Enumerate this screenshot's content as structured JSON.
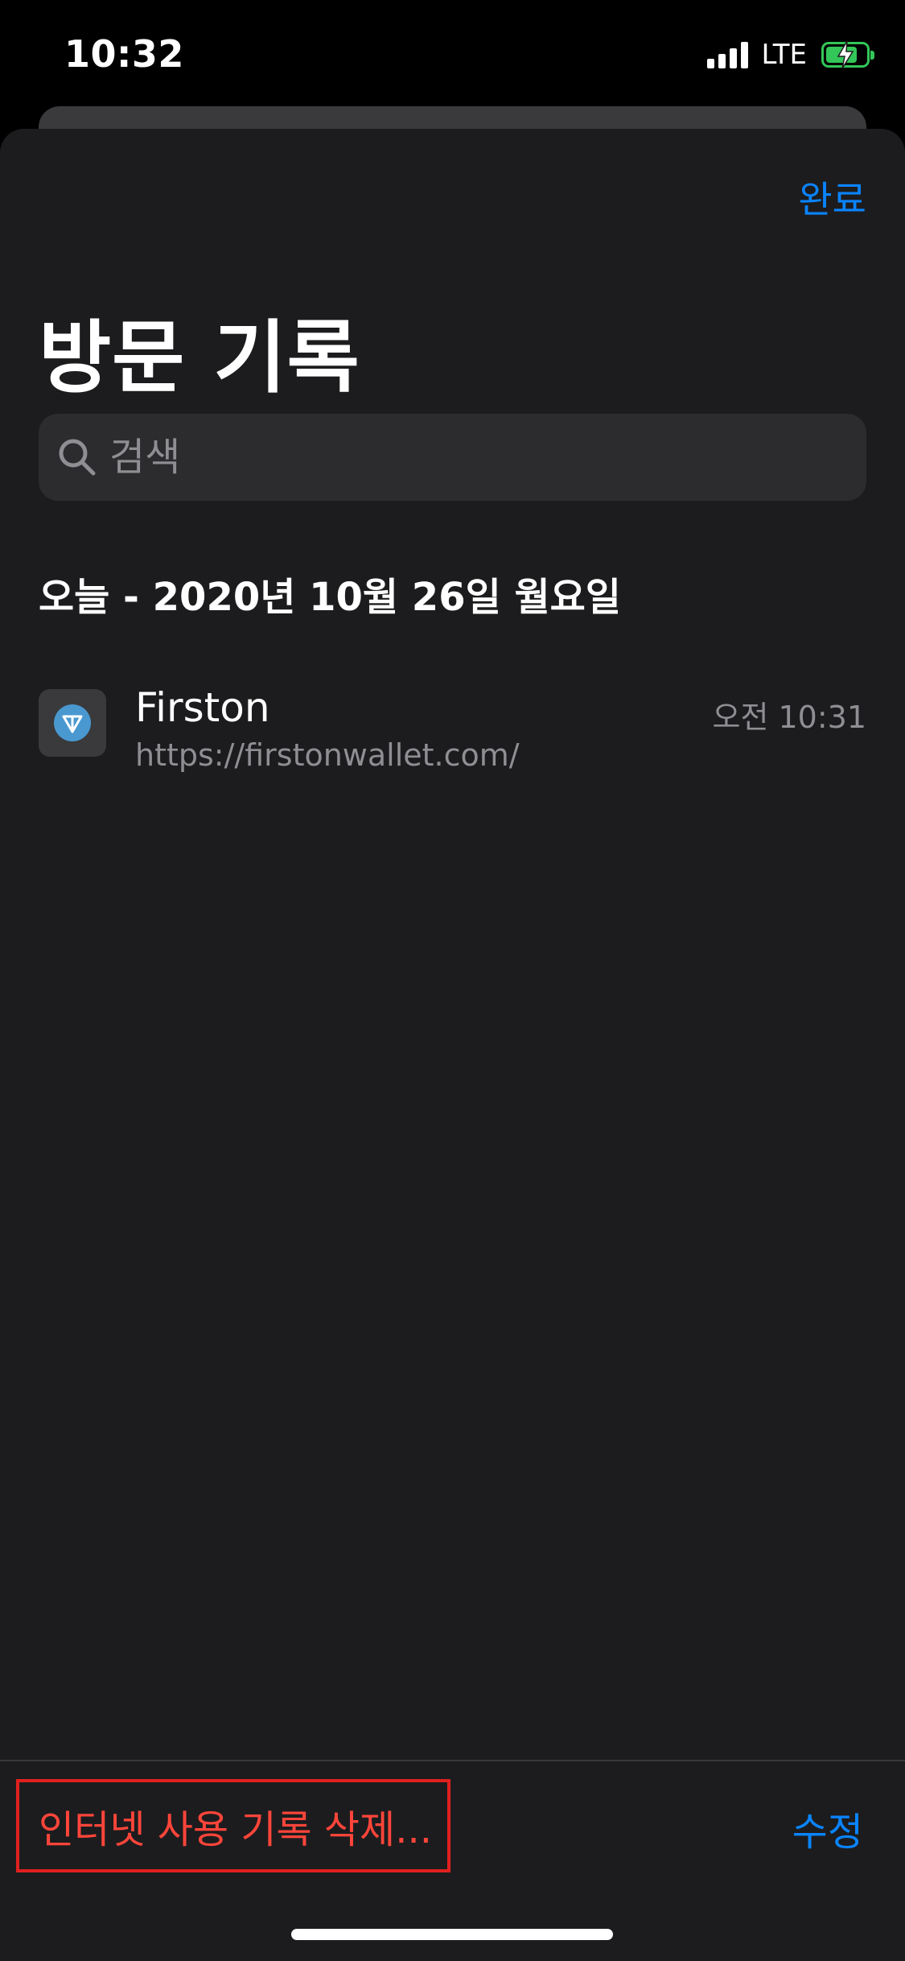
{
  "status_bar": {
    "time": "10:32",
    "network": "LTE",
    "signal_bars": 4,
    "battery_level": 0.8,
    "battery_charging": true,
    "battery_color": "#33c658"
  },
  "sheet": {
    "done_label": "완료",
    "title": "방문 기록"
  },
  "search": {
    "placeholder": "검색",
    "icon": "search-icon"
  },
  "history": {
    "section_title": "오늘 - 2020년 10월 26일 월요일",
    "items": [
      {
        "title": "Firston",
        "url": "https://firstonwallet.com/",
        "time": "오전 10:31",
        "icon": "ton-diamond-icon",
        "icon_color": "#4a98d0"
      }
    ]
  },
  "toolbar": {
    "clear_label": "인터넷 사용 기록 삭제...",
    "edit_label": "수정"
  },
  "colors": {
    "accent": "#0a84ff",
    "destructive": "#ff453a",
    "highlight_box": "#e0201f",
    "background": "#1c1c1e",
    "secondary_text": "#8e8e93"
  }
}
